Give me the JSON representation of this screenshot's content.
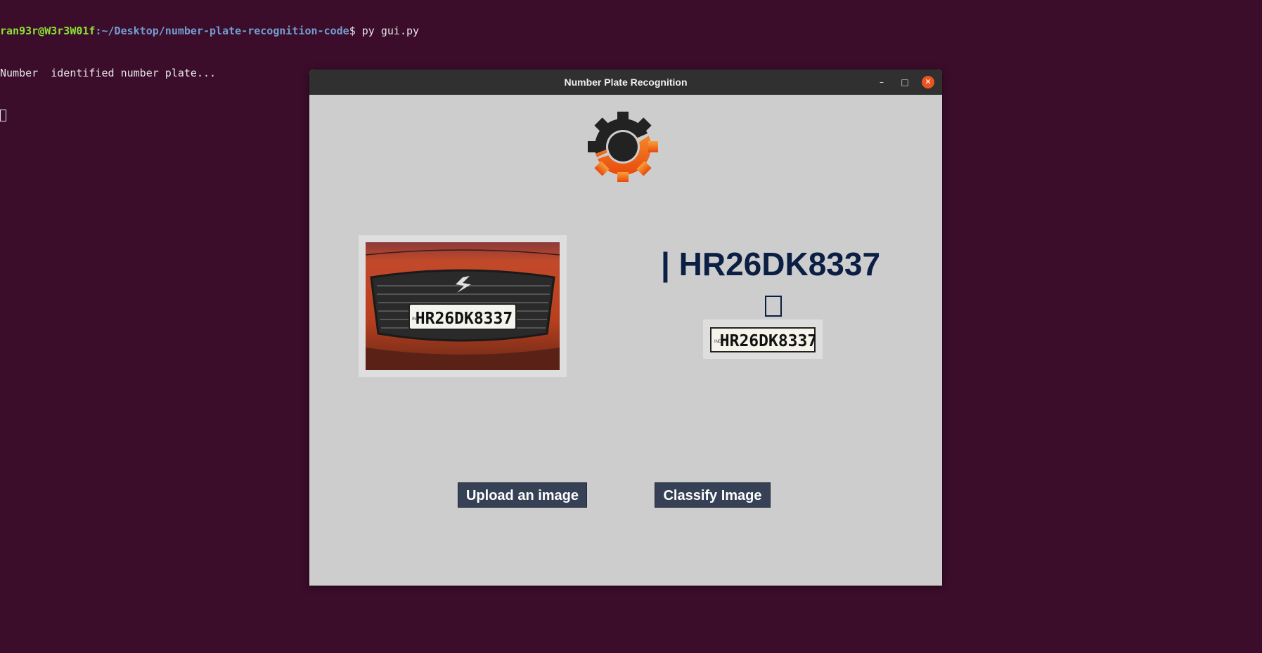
{
  "terminal": {
    "prompt_user": "ran93r@W3r3W01f",
    "prompt_path": ":~/Desktop/number-plate-recognition-code",
    "prompt_command": "$ py gui.py",
    "output_line": "Number  identified number plate..."
  },
  "window": {
    "title": "Number Plate Recognition",
    "minimize_glyph": "–",
    "maximize_glyph": "□",
    "close_glyph": "✕"
  },
  "result": {
    "plate_text": "| HR26DK8337"
  },
  "photo": {
    "plate_text": "HR26DK8337",
    "plate_prefix": "IND"
  },
  "crop": {
    "plate_text": "HR26DK8337",
    "plate_prefix": "IND"
  },
  "buttons": {
    "upload_label": "Upload an image",
    "classify_label": "Classify Image"
  },
  "colors": {
    "desktop_bg": "#3b0d2b",
    "window_bg": "#cdcdcd",
    "titlebar_bg": "#303030",
    "button_bg": "#364156",
    "result_text": "#0b1e44",
    "close_button": "#e95420",
    "logo_orange": "#f06a12"
  },
  "icons": {
    "logo": "gear-logo-icon"
  }
}
